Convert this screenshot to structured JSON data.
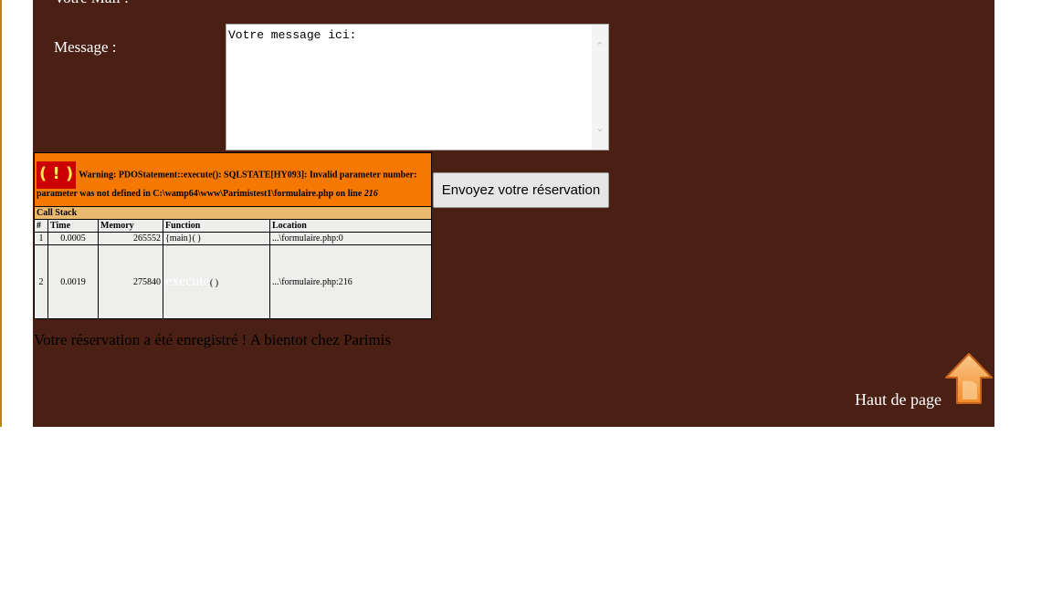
{
  "form": {
    "mail_label": "Votre Mail :",
    "message_label": "Message :",
    "message_value": "Votre message ici:",
    "submit_label": "Envoyez votre réservation"
  },
  "warning": {
    "icon_text": "( ! )",
    "text": "Warning: PDOStatement::execute(): SQLSTATE[HY093]: Invalid parameter number: parameter was not defined in C:\\wamp64\\www\\Parimistest1\\formulaire.php on line",
    "line": "216",
    "call_stack_title": "Call Stack",
    "columns": [
      "#",
      "Time",
      "Memory",
      "Function",
      "Location"
    ],
    "rows": [
      {
        "num": "1",
        "time": "0.0005",
        "memory": "265552",
        "function": "{main}( )",
        "location": "...\\formulaire.php:0"
      },
      {
        "num": "2",
        "time": "0.0019",
        "memory": "275840",
        "function_name": "execute",
        "function_args": "( )",
        "location": "...\\formulaire.php:216"
      }
    ]
  },
  "confirmation": "Votre réservation a été enregistré ! A bientot chez Parimis",
  "top_link": "Haut de page",
  "colors": {
    "panel": "#4a2015",
    "warning_bg": "#f57900",
    "stack_header_bg": "#e9b96e",
    "table_bg": "#eeeeec",
    "arrow": "#f5a04a"
  }
}
